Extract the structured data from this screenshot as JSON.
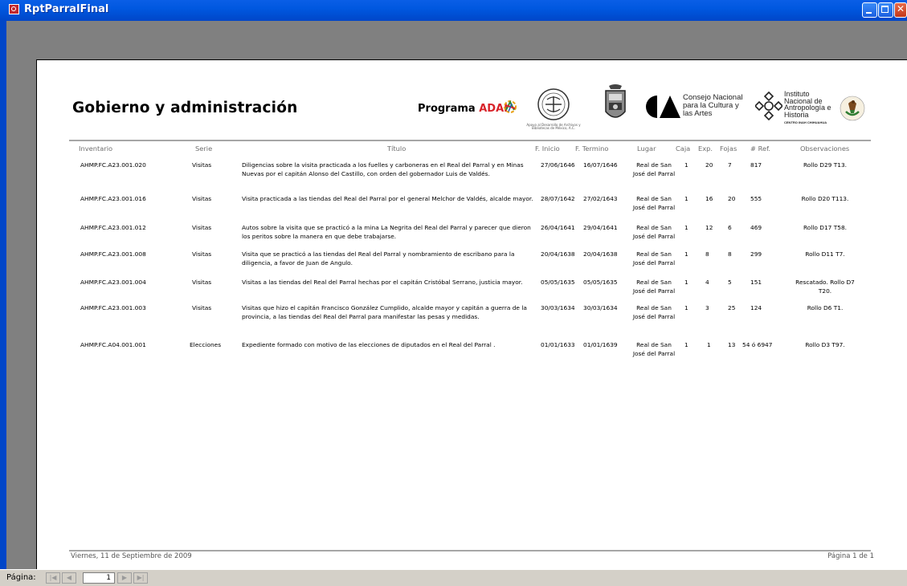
{
  "window": {
    "title": "RptParralFinal"
  },
  "report": {
    "title": "Gobierno y administración",
    "logos": {
      "adai_prefix": "Programa ",
      "adai_accent": "ADAI",
      "adai_caption": "Apoyo al Desarrollo de Archivos y Bibliotecas de México, A.C.",
      "conaculta": "Consejo Nacional para la Cultura y las Artes",
      "inah": "Instituto Nacional de Antropología e Historia",
      "inah_sub": "CENTRO INAH CHIHUAHUA"
    },
    "columns": [
      "Inventario",
      "Serie",
      "Título",
      "F. Inicio",
      "F. Termino",
      "Lugar",
      "Caja",
      "Exp.",
      "Fojas",
      "# Ref.",
      "Observaciones"
    ],
    "rows": [
      {
        "inventario": "AHMP.FC.A23.001.020",
        "serie": "Visitas",
        "titulo": "Diligencias sobre la visita practicada a los fuelles y carboneras en el Real del Parral y en Minas Nuevas por el capitán Alonso del Castillo, con orden del gobernador Luis de Valdés.",
        "inicio": "27/06/1646",
        "termino": "16/07/1646",
        "lugar": "Real de San José del Parral",
        "caja": "1",
        "exp": "20",
        "fojas": "7",
        "ref": "817",
        "obs": "Rollo D29 T13."
      },
      {
        "inventario": "AHMP.FC.A23.001.016",
        "serie": "Visitas",
        "titulo": "Visita practicada a las tiendas del Real del Parral por el general Melchor de Valdés, alcalde mayor.",
        "inicio": "28/07/1642",
        "termino": "27/02/1643",
        "lugar": "Real de San José del Parral",
        "caja": "1",
        "exp": "16",
        "fojas": "20",
        "ref": "555",
        "obs": "Rollo D20 T113."
      },
      {
        "inventario": "AHMP.FC.A23.001.012",
        "serie": "Visitas",
        "titulo": "Autos sobre la visita que se practicó a la mina La Negrita del Real del Parral y parecer que dieron los peritos sobre la manera en que debe trabajarse.",
        "inicio": "26/04/1641",
        "termino": "29/04/1641",
        "lugar": "Real de San José del Parral",
        "caja": "1",
        "exp": "12",
        "fojas": "6",
        "ref": "469",
        "obs": "Rollo D17 T58."
      },
      {
        "inventario": "AHMP.FC.A23.001.008",
        "serie": "Visitas",
        "titulo": "Visita que se practicó a las tiendas del Real del Parral y nombramiento de escribano para la diligencia, a favor de Juan de Angulo.",
        "inicio": "20/04/1638",
        "termino": "20/04/1638",
        "lugar": "Real de San José del Parral",
        "caja": "1",
        "exp": "8",
        "fojas": "8",
        "ref": "299",
        "obs": "Rollo D11 T7."
      },
      {
        "inventario": "AHMP.FC.A23.001.004",
        "serie": "Visitas",
        "titulo": "Visitas a las tiendas del Real del Parral hechas por el capitán Cristóbal Serrano, justicia mayor.",
        "inicio": "05/05/1635",
        "termino": "05/05/1635",
        "lugar": "Real de San José del Parral",
        "caja": "1",
        "exp": "4",
        "fojas": "5",
        "ref": "151",
        "obs": "Rescatado. Rollo D7 T20."
      },
      {
        "inventario": "AHMP.FC.A23.001.003",
        "serie": "Visitas",
        "titulo": "Visitas que hizo el capitán Francisco González Cumplido, alcalde mayor y capitán a guerra de la provincia, a las tiendas del Real del Parral para manifestar las pesas y medidas.",
        "inicio": "30/03/1634",
        "termino": "30/03/1634",
        "lugar": "Real de San José del Parral",
        "caja": "1",
        "exp": "3",
        "fojas": "25",
        "ref": "124",
        "obs": "Rollo D6 T1."
      },
      {
        "inventario": "AHMP.FC.A04.001.001",
        "serie": "Elecciones",
        "titulo": "Expediente formado con motivo de las elecciones de diputados en el Real del Parral .",
        "inicio": "01/01/1633",
        "termino": "01/01/1639",
        "lugar": "Real de San José del Parral",
        "caja": "1",
        "exp": "1",
        "fojas": "13",
        "ref": "54 ó 6947",
        "obs": "Rollo D3 T97."
      }
    ],
    "footer": {
      "date": "Viernes, 11 de Septiembre de 2009",
      "page": "Página 1 de 1"
    }
  },
  "navigation": {
    "label": "Página:",
    "current_page": "1"
  },
  "colors": {
    "titlebar": "#0058e0",
    "adai_accent": "#d8232a",
    "rule": "#a6a6a6"
  }
}
